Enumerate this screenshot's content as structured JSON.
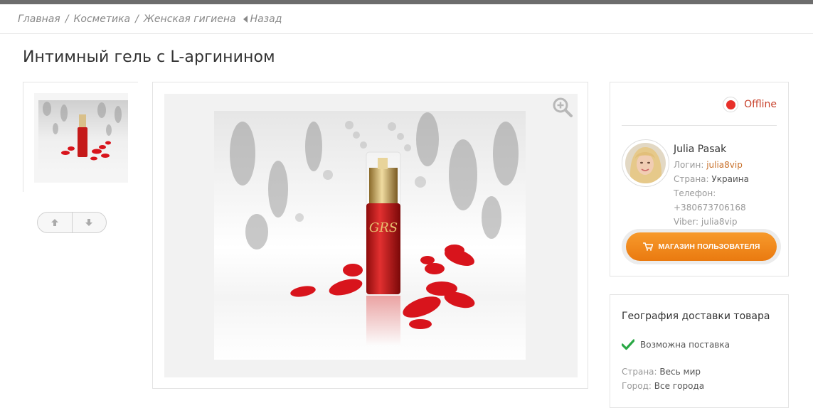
{
  "breadcrumbs": {
    "home": "Главная",
    "cat1": "Косметика",
    "cat2": "Женская гигиена",
    "back": "Назад"
  },
  "product": {
    "title": "Интимный гель с L-аргинином"
  },
  "seller": {
    "status": "Offline",
    "name": "Julia Pasak",
    "login_label": "Логин:",
    "login": "julia8vip",
    "country_label": "Страна:",
    "country": "Украина",
    "phone_label": "Телефон:",
    "phone": "+380673706168",
    "viber_label": "Viber:",
    "viber": "julia8vip",
    "shop_button": "МАГАЗИН ПОЛЬЗОВАТЕЛЯ"
  },
  "delivery": {
    "title": "География доставки товара",
    "possible": "Возможна поставка",
    "country_label": "Страна:",
    "country": "Весь мир",
    "city_label": "Город:",
    "city": "Все города"
  },
  "colors": {
    "accent": "#ea7a10",
    "offline": "#e8302a",
    "check": "#2aa845"
  },
  "icons": [
    "back-arrow-icon",
    "up-arrow-icon",
    "down-arrow-icon",
    "zoom-in-icon",
    "cart-icon",
    "check-icon"
  ]
}
